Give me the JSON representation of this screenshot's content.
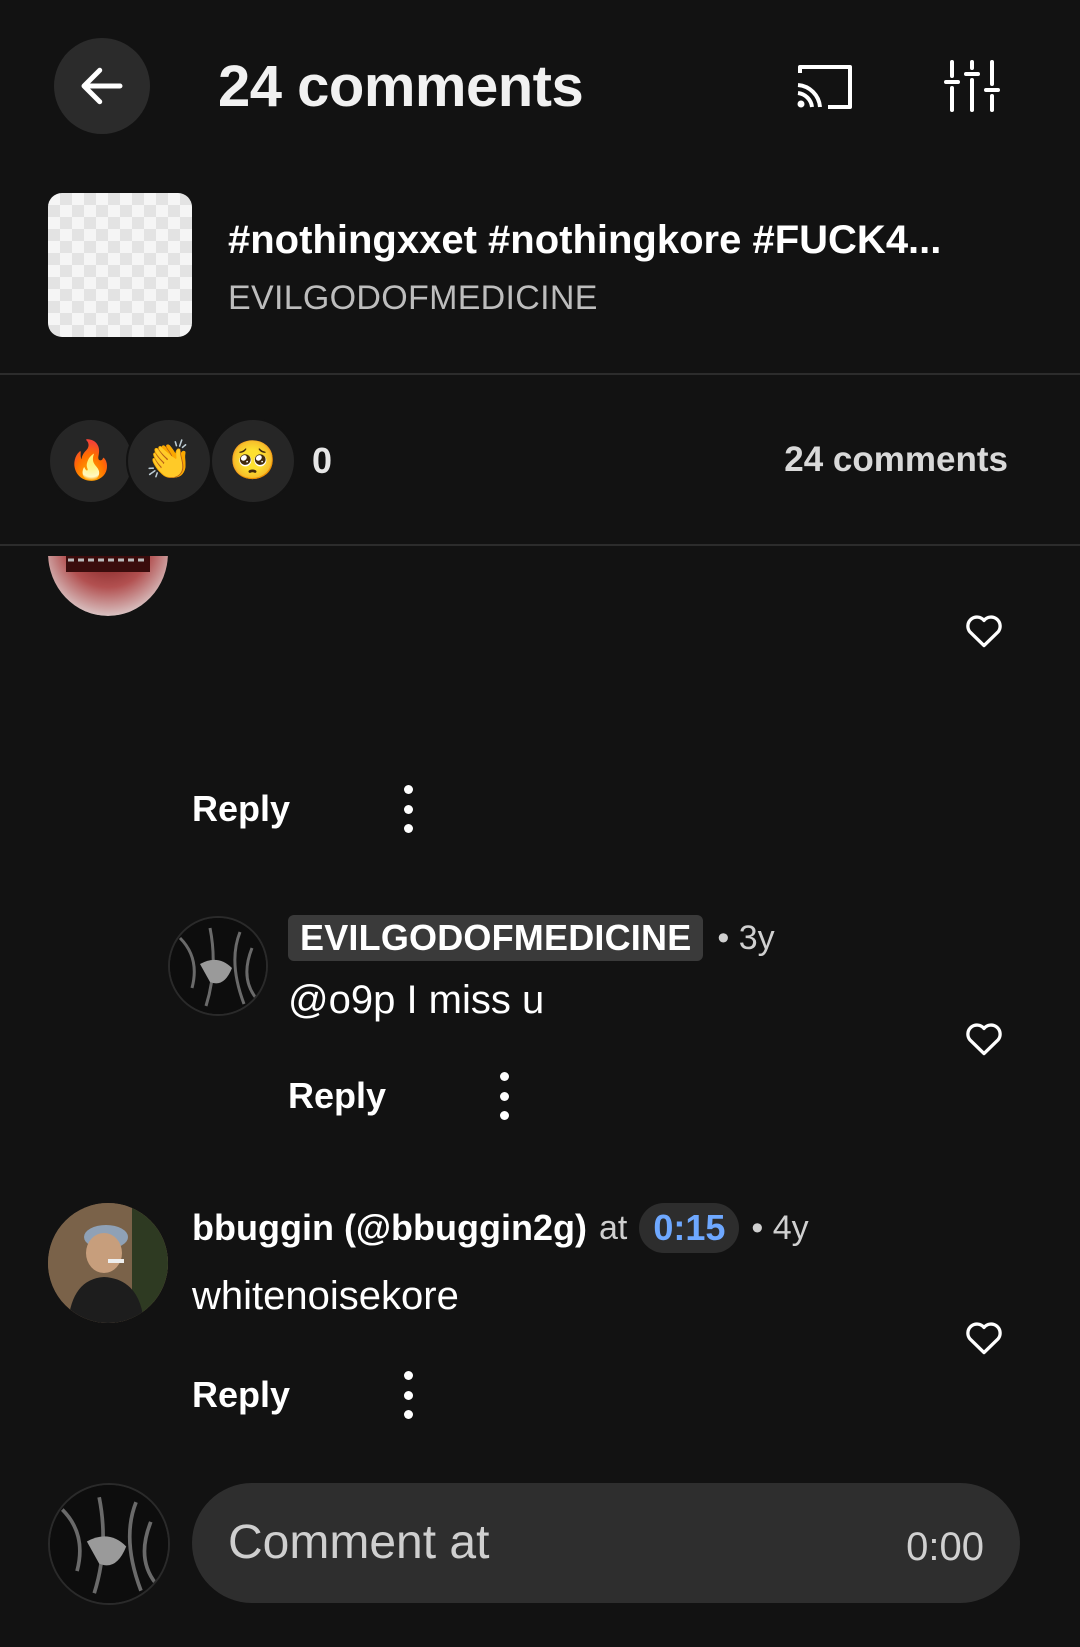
{
  "header": {
    "title": "24 comments",
    "back_icon": "arrow-left-icon",
    "cast_icon": "cast-icon",
    "settings_icon": "sliders-icon"
  },
  "track": {
    "title": "#nothingxxet #nothingkore #FUCK4...",
    "artist": "EVILGODOFMEDICINE"
  },
  "reactions": {
    "emojis": [
      "🔥",
      "👏",
      "🥺"
    ],
    "count": "0",
    "comments_label": "24 comments"
  },
  "comments": [
    {
      "reply_label": "Reply"
    },
    {
      "username": "EVILGODOFMEDICINE",
      "age": "• 3y",
      "text": "@o9p I miss u",
      "reply_label": "Reply"
    },
    {
      "username": "bbuggin (@bbuggin2g)",
      "at_label": "at",
      "timestamp": "0:15",
      "age": "• 4y",
      "text": "whitenoisekore",
      "reply_label": "Reply"
    }
  ],
  "composer": {
    "placeholder": "Comment at",
    "time": "0:00"
  },
  "colors": {
    "background": "#121212",
    "timestamp_accent": "#6ea8ff"
  }
}
